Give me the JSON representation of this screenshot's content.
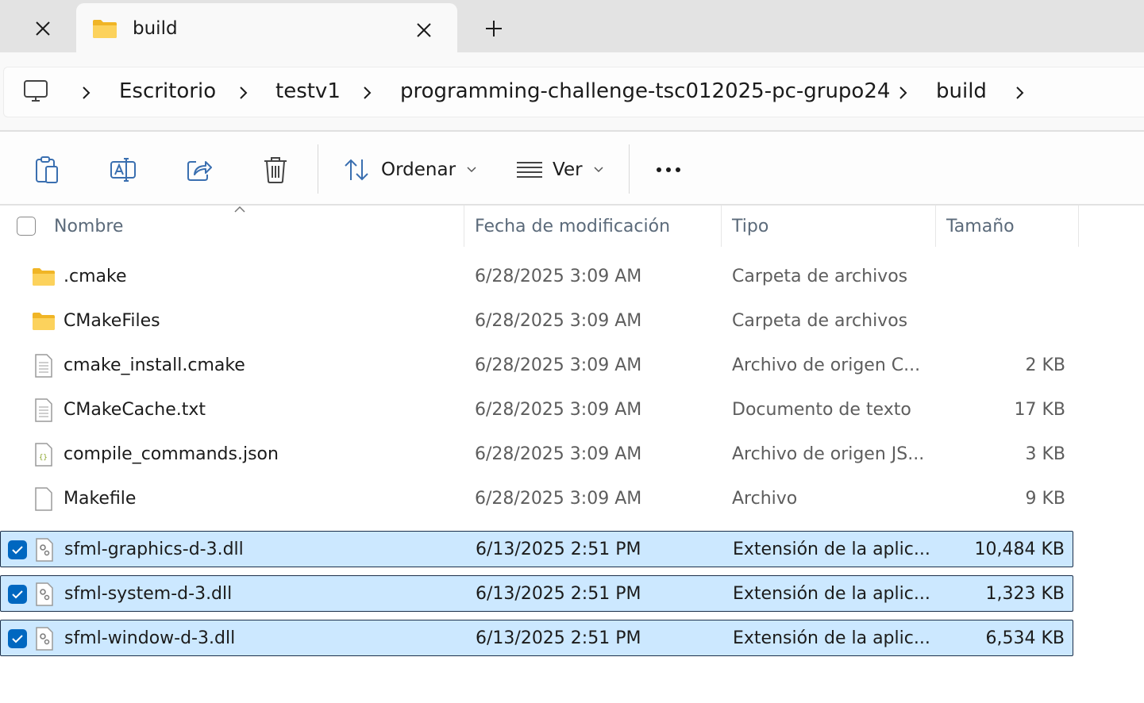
{
  "tabs": [
    {
      "title": "build",
      "icon": "folder-icon",
      "active": true
    }
  ],
  "breadcrumb": {
    "root_icon": "computer-icon",
    "items": [
      "Escritorio",
      "testv1",
      "programming-challenge-tsc012025-pc-grupo24",
      "build"
    ]
  },
  "toolbar": {
    "sort_label": "Ordenar",
    "view_label": "Ver",
    "buttons": [
      "paste-icon",
      "rename-icon",
      "share-icon",
      "delete-icon",
      "more-icon"
    ]
  },
  "columns": {
    "name": "Nombre",
    "date": "Fecha de modificación",
    "type": "Tipo",
    "size": "Tamaño"
  },
  "files": [
    {
      "name": ".cmake",
      "date": "6/28/2025 3:09 AM",
      "type": "Carpeta de archivos",
      "size": "",
      "icon": "folder-icon",
      "selected": false
    },
    {
      "name": "CMakeFiles",
      "date": "6/28/2025 3:09 AM",
      "type": "Carpeta de archivos",
      "size": "",
      "icon": "folder-icon",
      "selected": false
    },
    {
      "name": "cmake_install.cmake",
      "date": "6/28/2025 3:09 AM",
      "type": "Archivo de origen C...",
      "size": "2 KB",
      "icon": "text-file-icon",
      "selected": false
    },
    {
      "name": "CMakeCache.txt",
      "date": "6/28/2025 3:09 AM",
      "type": "Documento de texto",
      "size": "17 KB",
      "icon": "text-file-icon",
      "selected": false
    },
    {
      "name": "compile_commands.json",
      "date": "6/28/2025 3:09 AM",
      "type": "Archivo de origen JS...",
      "size": "3 KB",
      "icon": "json-file-icon",
      "selected": false
    },
    {
      "name": "Makefile",
      "date": "6/28/2025 3:09 AM",
      "type": "Archivo",
      "size": "9 KB",
      "icon": "blank-file-icon",
      "selected": false
    },
    {
      "name": "sfml-graphics-d-3.dll",
      "date": "6/13/2025 2:51 PM",
      "type": "Extensión de la aplic...",
      "size": "10,484 KB",
      "icon": "dll-file-icon",
      "selected": true
    },
    {
      "name": "sfml-system-d-3.dll",
      "date": "6/13/2025 2:51 PM",
      "type": "Extensión de la aplic...",
      "size": "1,323 KB",
      "icon": "dll-file-icon",
      "selected": true
    },
    {
      "name": "sfml-window-d-3.dll",
      "date": "6/13/2025 2:51 PM",
      "type": "Extensión de la aplic...",
      "size": "6,534 KB",
      "icon": "dll-file-icon",
      "selected": true
    }
  ],
  "colors": {
    "selection_bg": "#cce8ff",
    "selection_border": "#1b2f4a",
    "checkbox_accent": "#0067c0",
    "folder_yellow": "#f8c43c"
  }
}
